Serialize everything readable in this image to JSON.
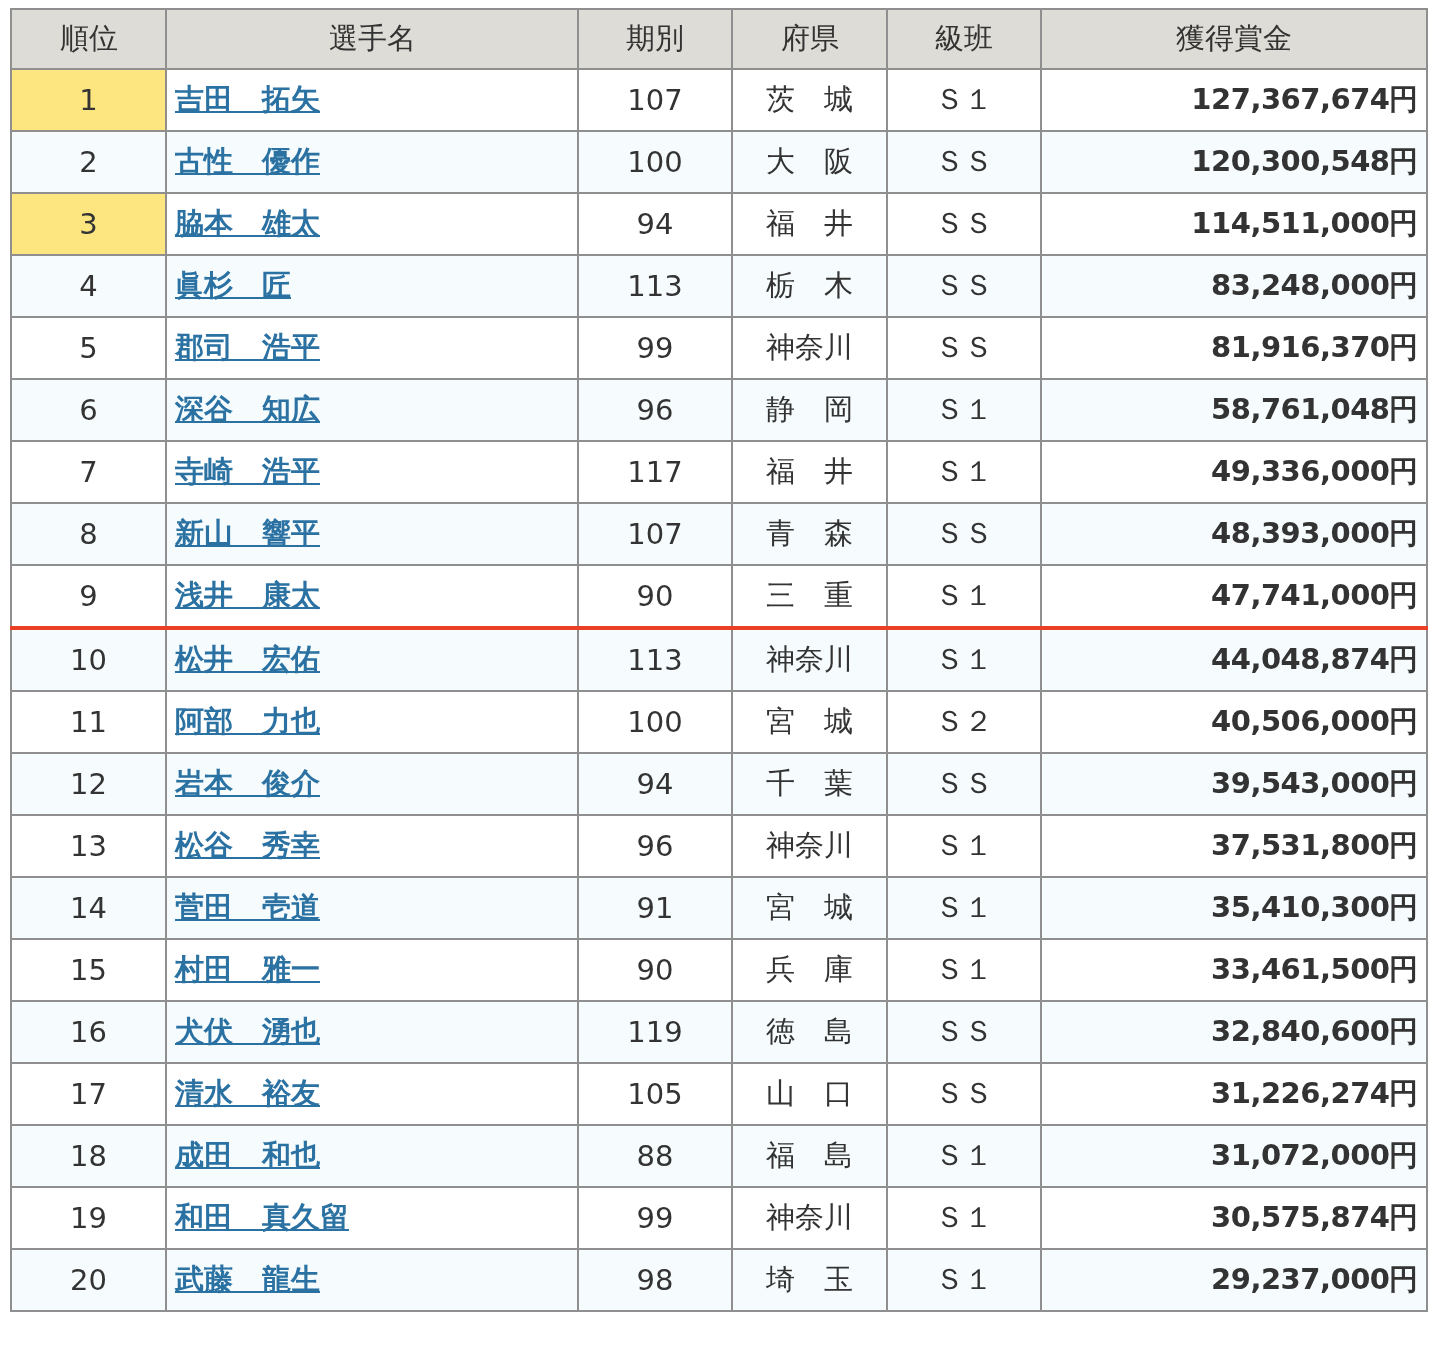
{
  "table": {
    "columns": [
      "順位",
      "選手名",
      "期別",
      "府県",
      "級班",
      "獲得賞金"
    ],
    "rows": [
      {
        "rank": "1",
        "name": "吉田　拓矢",
        "term": "107",
        "pref": "茨　城",
        "class": "Ｓ１",
        "prize": "127,367,674円",
        "highlight": true,
        "line_below": false
      },
      {
        "rank": "2",
        "name": "古性　優作",
        "term": "100",
        "pref": "大　阪",
        "class": "ＳＳ",
        "prize": "120,300,548円",
        "highlight": false,
        "line_below": false
      },
      {
        "rank": "3",
        "name": "脇本　雄太",
        "term": "94",
        "pref": "福　井",
        "class": "ＳＳ",
        "prize": "114,511,000円",
        "highlight": true,
        "line_below": false
      },
      {
        "rank": "4",
        "name": "眞杉　匠",
        "term": "113",
        "pref": "栃　木",
        "class": "ＳＳ",
        "prize": "83,248,000円",
        "highlight": false,
        "line_below": false
      },
      {
        "rank": "5",
        "name": "郡司　浩平",
        "term": "99",
        "pref": "神奈川",
        "class": "ＳＳ",
        "prize": "81,916,370円",
        "highlight": false,
        "line_below": false
      },
      {
        "rank": "6",
        "name": "深谷　知広",
        "term": "96",
        "pref": "静　岡",
        "class": "Ｓ１",
        "prize": "58,761,048円",
        "highlight": false,
        "line_below": false
      },
      {
        "rank": "7",
        "name": "寺崎　浩平",
        "term": "117",
        "pref": "福　井",
        "class": "Ｓ１",
        "prize": "49,336,000円",
        "highlight": false,
        "line_below": false
      },
      {
        "rank": "8",
        "name": "新山　響平",
        "term": "107",
        "pref": "青　森",
        "class": "ＳＳ",
        "prize": "48,393,000円",
        "highlight": false,
        "line_below": false
      },
      {
        "rank": "9",
        "name": "浅井　康太",
        "term": "90",
        "pref": "三　重",
        "class": "Ｓ１",
        "prize": "47,741,000円",
        "highlight": false,
        "line_below": true
      },
      {
        "rank": "10",
        "name": "松井　宏佑",
        "term": "113",
        "pref": "神奈川",
        "class": "Ｓ１",
        "prize": "44,048,874円",
        "highlight": false,
        "line_below": false
      },
      {
        "rank": "11",
        "name": "阿部　力也",
        "term": "100",
        "pref": "宮　城",
        "class": "Ｓ２",
        "prize": "40,506,000円",
        "highlight": false,
        "line_below": false
      },
      {
        "rank": "12",
        "name": "岩本　俊介",
        "term": "94",
        "pref": "千　葉",
        "class": "ＳＳ",
        "prize": "39,543,000円",
        "highlight": false,
        "line_below": false
      },
      {
        "rank": "13",
        "name": "松谷　秀幸",
        "term": "96",
        "pref": "神奈川",
        "class": "Ｓ１",
        "prize": "37,531,800円",
        "highlight": false,
        "line_below": false
      },
      {
        "rank": "14",
        "name": "菅田　壱道",
        "term": "91",
        "pref": "宮　城",
        "class": "Ｓ１",
        "prize": "35,410,300円",
        "highlight": false,
        "line_below": false
      },
      {
        "rank": "15",
        "name": "村田　雅一",
        "term": "90",
        "pref": "兵　庫",
        "class": "Ｓ１",
        "prize": "33,461,500円",
        "highlight": false,
        "line_below": false
      },
      {
        "rank": "16",
        "name": "犬伏　湧也",
        "term": "119",
        "pref": "徳　島",
        "class": "ＳＳ",
        "prize": "32,840,600円",
        "highlight": false,
        "line_below": false
      },
      {
        "rank": "17",
        "name": "清水　裕友",
        "term": "105",
        "pref": "山　口",
        "class": "ＳＳ",
        "prize": "31,226,274円",
        "highlight": false,
        "line_below": false
      },
      {
        "rank": "18",
        "name": "成田　和也",
        "term": "88",
        "pref": "福　島",
        "class": "Ｓ１",
        "prize": "31,072,000円",
        "highlight": false,
        "line_below": false
      },
      {
        "rank": "19",
        "name": "和田　真久留",
        "term": "99",
        "pref": "神奈川",
        "class": "Ｓ１",
        "prize": "30,575,874円",
        "highlight": false,
        "line_below": false
      },
      {
        "rank": "20",
        "name": "武藤　龍生",
        "term": "98",
        "pref": "埼　玉",
        "class": "Ｓ１",
        "prize": "29,237,000円",
        "highlight": false,
        "line_below": false
      }
    ]
  }
}
